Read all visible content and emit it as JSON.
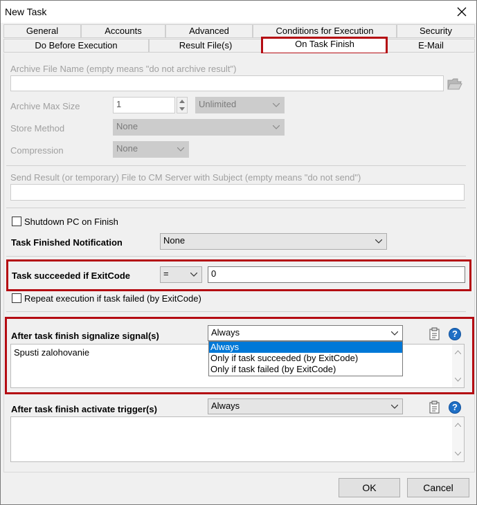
{
  "window": {
    "title": "New Task"
  },
  "tabs": {
    "row1": [
      "General",
      "Accounts",
      "Advanced",
      "Conditions for Execution",
      "Security"
    ],
    "row2": [
      "Do Before Execution",
      "Result File(s)",
      "On Task Finish",
      "E-Mail"
    ]
  },
  "archive": {
    "file_name_label": "Archive File Name (empty means \"do not archive result\")",
    "file_name_value": "",
    "max_size_label": "Archive Max Size",
    "max_size_value": "1",
    "max_size_unit": "Unlimited",
    "store_method_label": "Store Method",
    "store_method_value": "None",
    "compression_label": "Compression",
    "compression_value": "None"
  },
  "send_result": {
    "label": "Send Result (or temporary) File to CM Server with Subject (empty means \"do not send\")",
    "value": ""
  },
  "shutdown": {
    "label": "Shutdown PC on Finish",
    "checked": false
  },
  "notification": {
    "label": "Task Finished Notification",
    "value": "None"
  },
  "exitcode": {
    "label": "Task succeeded if ExitCode",
    "operator": "=",
    "value": "0"
  },
  "repeat": {
    "label": "Repeat execution if task failed (by ExitCode)",
    "checked": false
  },
  "signals": {
    "label": "After task finish signalize signal(s)",
    "selected": "Always",
    "options": [
      "Always",
      "Only if task succeeded (by ExitCode)",
      "Only if task failed (by ExitCode)"
    ],
    "memo_text": "Spusti zalohovanie"
  },
  "triggers": {
    "label": "After task finish activate trigger(s)",
    "selected": "Always",
    "memo_text": ""
  },
  "buttons": {
    "ok": "OK",
    "cancel": "Cancel"
  },
  "colors": {
    "highlight_red": "#b40b12",
    "selection_blue": "#0078d7"
  }
}
